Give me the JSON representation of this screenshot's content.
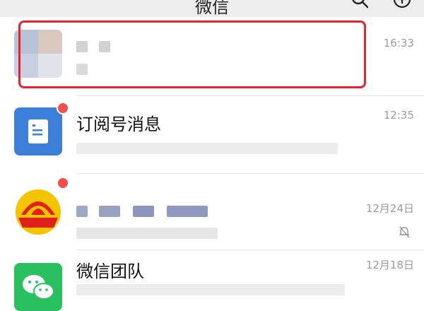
{
  "header": {
    "title": "微信",
    "search_icon": "search-icon",
    "add_icon": "add-icon"
  },
  "chats": [
    {
      "name": "",
      "time": "16:33",
      "avatar": "blurred-avatar",
      "unread_dot": false,
      "highlighted": true
    },
    {
      "name": "订阅号消息",
      "time": "12:35",
      "avatar": "subscription-icon",
      "unread_dot": true
    },
    {
      "name": "",
      "time": "12月24日",
      "avatar": "petrochina-logo",
      "unread_dot": true,
      "muted_icon": "bell-off-icon"
    },
    {
      "name": "微信团队",
      "time": "12月18日",
      "avatar": "wechat-logo",
      "unread_dot": false
    }
  ],
  "colors": {
    "header_bg": "#ededed",
    "unread_dot": "#f44d4d",
    "highlight_border": "#e8232d",
    "subscription_blue": "#3b7fd9",
    "wechat_green": "#29c15f"
  }
}
